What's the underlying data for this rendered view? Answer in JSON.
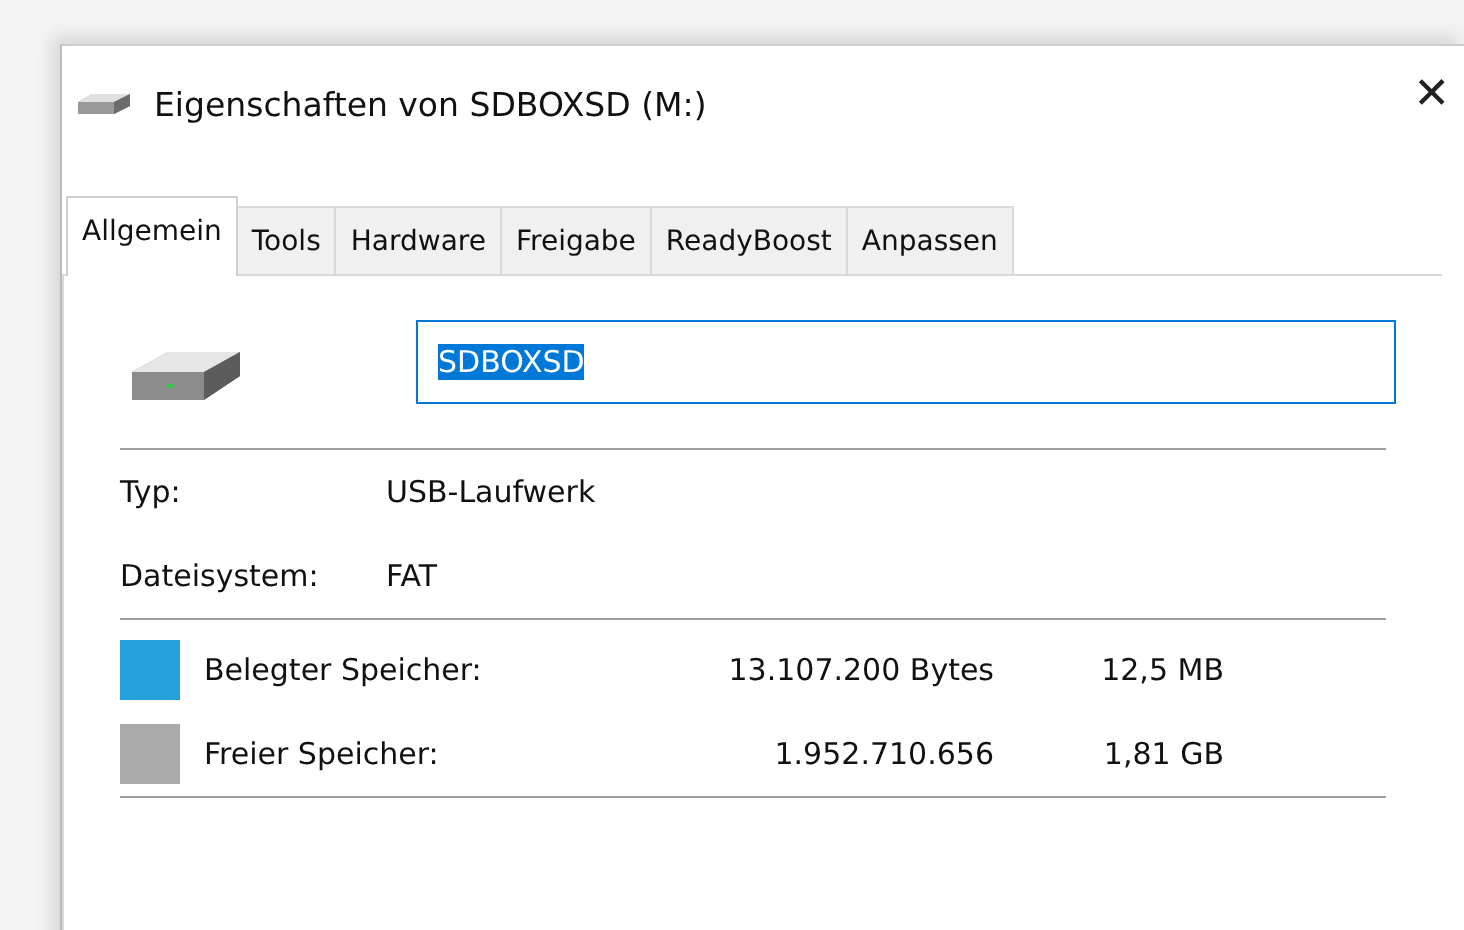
{
  "window": {
    "title": "Eigenschaften von SDBOXSD (M:)",
    "close": "✕"
  },
  "tabs": [
    {
      "label": "Allgemein",
      "selected": true
    },
    {
      "label": "Tools",
      "selected": false
    },
    {
      "label": "Hardware",
      "selected": false
    },
    {
      "label": "Freigabe",
      "selected": false
    },
    {
      "label": "ReadyBoost",
      "selected": false
    },
    {
      "label": "Anpassen",
      "selected": false
    }
  ],
  "name_field": {
    "value": "SDBOXSD",
    "text_selected": true
  },
  "properties": [
    {
      "label": "Typ:",
      "value": "USB-Laufwerk"
    },
    {
      "label": "Dateisystem:",
      "value": "FAT"
    }
  ],
  "storage": [
    {
      "label": "Belegter Speicher:",
      "bytes": "13.107.200 Bytes",
      "size": "12,5 MB",
      "color": "#26a0da"
    },
    {
      "label": "Freier Speicher:",
      "bytes": "1.952.710.656",
      "size": "1,81 GB",
      "color": "#aaaaaa"
    }
  ]
}
